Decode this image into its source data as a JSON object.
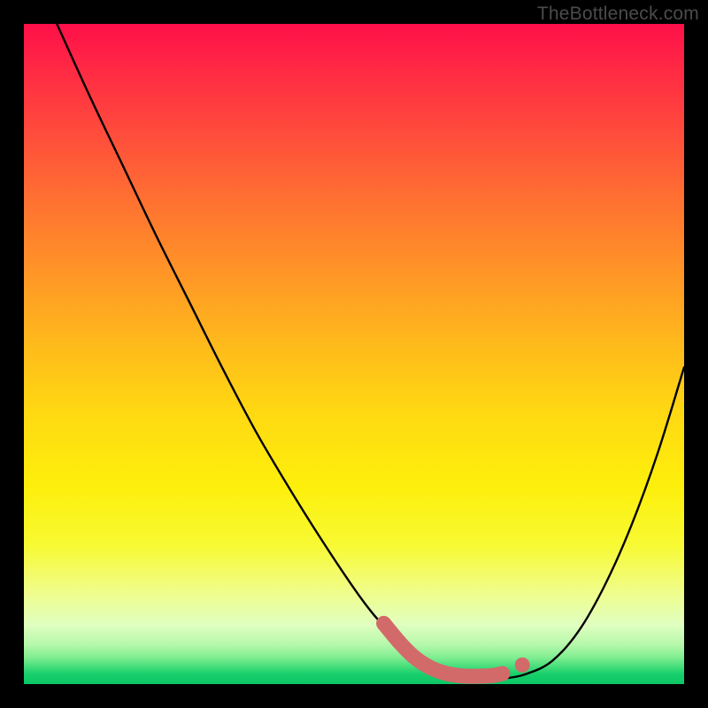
{
  "attribution": "TheBottleneck.com",
  "chart_data": {
    "type": "line",
    "title": "",
    "xlabel": "",
    "ylabel": "",
    "xlim": [
      0,
      100
    ],
    "ylim": [
      0,
      100
    ],
    "grid": false,
    "legend": false,
    "background": "rainbow-heat-gradient",
    "series": [
      {
        "name": "bottleneck-curve",
        "color": "#000000",
        "x": [
          5,
          10,
          15,
          20,
          25,
          30,
          35,
          40,
          45,
          50,
          53,
          56,
          59,
          62,
          65,
          68,
          71,
          73,
          76,
          80,
          84,
          88,
          92,
          96,
          100
        ],
        "y": [
          100,
          89,
          78.5,
          68,
          58,
          48,
          38.5,
          30,
          22,
          14.5,
          10.5,
          7.3,
          4.8,
          3.0,
          1.8,
          1.1,
          0.8,
          0.9,
          1.5,
          3.5,
          8,
          15,
          24,
          35,
          48
        ]
      },
      {
        "name": "optimal-range-marker",
        "color": "#d26a6a",
        "style": "thick-rounded",
        "x": [
          54.5,
          57,
          59,
          61,
          63,
          65,
          67,
          69,
          71,
          72.5,
          74,
          75.5
        ],
        "y": [
          9.2,
          6.2,
          4.2,
          2.8,
          1.9,
          1.4,
          1.2,
          1.2,
          1.3,
          1.6,
          2.1,
          2.9
        ]
      }
    ],
    "annotations": []
  }
}
